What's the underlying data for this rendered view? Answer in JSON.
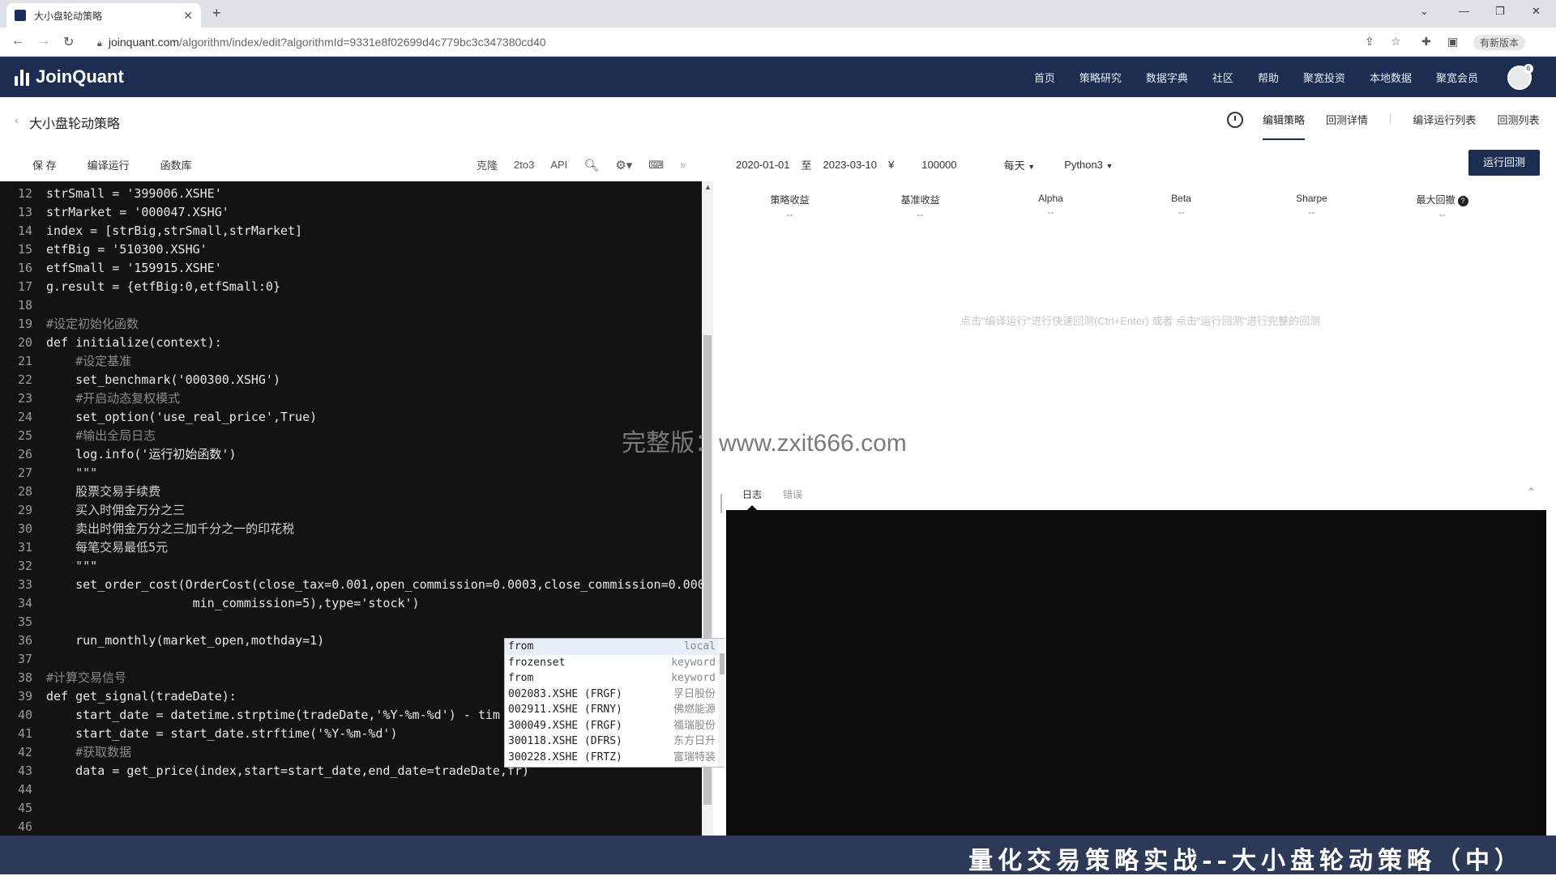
{
  "browser": {
    "tab_title": "大小盘轮动策略",
    "url_host": "joinquant.com",
    "url_path": "/algorithm/index/edit?algorithmId=9331e8f02699d4c779bc3c347380cd40",
    "profile_label": "有新版本"
  },
  "site": {
    "logo": "JoinQuant",
    "nav": [
      "首页",
      "策略研究",
      "数据字典",
      "社区",
      "帮助",
      "聚宽投资",
      "本地数据",
      "聚宽会员"
    ],
    "avatar_badge": "6"
  },
  "strategy": {
    "title": "大小盘轮动策略",
    "right_tabs": [
      "编辑策略",
      "回测详情",
      "编译运行列表",
      "回测列表"
    ]
  },
  "toolbar": {
    "save": "保 存",
    "compile_run": "编译运行",
    "function_lib": "函数库",
    "clone": "克隆",
    "to3": "2to3",
    "api": "API",
    "start_date": "2020-01-01",
    "to_label": "至",
    "end_date": "2023-03-10",
    "currency": "¥",
    "capital": "100000",
    "frequency": "每天",
    "language": "Python3",
    "run_backtest": "运行回测"
  },
  "editor": {
    "lines": [
      {
        "n": "12",
        "t": "strSmall = '399006.XSHE'",
        "k": "code"
      },
      {
        "n": "13",
        "t": "strMarket = '000047.XSHG'",
        "k": "code"
      },
      {
        "n": "14",
        "t": "index = [strBig,strSmall,strMarket]",
        "k": "code"
      },
      {
        "n": "15",
        "t": "etfBig = '510300.XSHG'",
        "k": "code"
      },
      {
        "n": "16",
        "t": "etfSmall = '159915.XSHE'",
        "k": "code"
      },
      {
        "n": "17",
        "t": "g.result = {etfBig:0,etfSmall:0}",
        "k": "code"
      },
      {
        "n": "18",
        "t": "",
        "k": "code"
      },
      {
        "n": "19",
        "t": "#设定初始化函数",
        "k": "cm"
      },
      {
        "n": "20",
        "t": "def initialize(context):",
        "k": "code"
      },
      {
        "n": "21",
        "t": "    #设定基准",
        "k": "cm"
      },
      {
        "n": "22",
        "t": "    set_benchmark('000300.XSHG')",
        "k": "code"
      },
      {
        "n": "23",
        "t": "    #开启动态复权模式",
        "k": "cm"
      },
      {
        "n": "24",
        "t": "    set_option('use_real_price',True)",
        "k": "code"
      },
      {
        "n": "25",
        "t": "    #输出全局日志",
        "k": "cm"
      },
      {
        "n": "26",
        "t": "    log.info('运行初始函数')",
        "k": "code"
      },
      {
        "n": "27",
        "t": "    \"\"\"",
        "k": "ds"
      },
      {
        "n": "28",
        "t": "    股票交易手续费",
        "k": "ds"
      },
      {
        "n": "29",
        "t": "    买入时佣金万分之三",
        "k": "ds"
      },
      {
        "n": "30",
        "t": "    卖出时佣金万分之三加千分之一的印花税",
        "k": "ds"
      },
      {
        "n": "31",
        "t": "    每笔交易最低5元",
        "k": "ds"
      },
      {
        "n": "32",
        "t": "    \"\"\"",
        "k": "ds"
      },
      {
        "n": "33",
        "t": "    set_order_cost(OrderCost(close_tax=0.001,open_commission=0.0003,close_commission=0.000",
        "k": "code"
      },
      {
        "n": "34",
        "t": "                    min_commission=5),type='stock')",
        "k": "code"
      },
      {
        "n": "35",
        "t": "",
        "k": "code"
      },
      {
        "n": "36",
        "t": "    run_monthly(market_open,mothday=1)",
        "k": "code"
      },
      {
        "n": "37",
        "t": "",
        "k": "code"
      },
      {
        "n": "38",
        "t": "#计算交易信号",
        "k": "cm"
      },
      {
        "n": "39",
        "t": "def get_signal(tradeDate):",
        "k": "code"
      },
      {
        "n": "40",
        "t": "    start_date = datetime.strptime(tradeDate,'%Y-%m-%d') - tim",
        "k": "code"
      },
      {
        "n": "41",
        "t": "    start_date = start_date.strftime('%Y-%m-%d')",
        "k": "code"
      },
      {
        "n": "42",
        "t": "    #获取数据",
        "k": "cm"
      },
      {
        "n": "43",
        "t": "    data = get_price(index,start=start_date,end_date=tradeDate,fr)",
        "k": "code"
      },
      {
        "n": "44",
        "t": "",
        "k": "code"
      },
      {
        "n": "45",
        "t": "",
        "k": "code"
      },
      {
        "n": "46",
        "t": "",
        "k": "code"
      }
    ]
  },
  "autocomplete": [
    {
      "name": "from",
      "meta": "local"
    },
    {
      "name": "frozenset",
      "meta": "keyword"
    },
    {
      "name": "from",
      "meta": "keyword"
    },
    {
      "name": "002083.XSHE (FRGF)",
      "meta": "孚日股份"
    },
    {
      "name": "002911.XSHE (FRNY)",
      "meta": "佛燃能源"
    },
    {
      "name": "300049.XSHE (FRGF)",
      "meta": "福瑞股份"
    },
    {
      "name": "300118.XSHE (DFRS)",
      "meta": "东方日升"
    },
    {
      "name": "300228.XSHE (FRTZ)",
      "meta": "富瑞特装"
    }
  ],
  "results": {
    "metrics": [
      {
        "label": "策略收益",
        "value": "--"
      },
      {
        "label": "基准收益",
        "value": "--"
      },
      {
        "label": "Alpha",
        "value": "--"
      },
      {
        "label": "Beta",
        "value": "--"
      },
      {
        "label": "Sharpe",
        "value": "--"
      },
      {
        "label": "最大回撤",
        "value": "--"
      }
    ],
    "hint": "点击\"编译运行\"进行快速回测(Ctrl+Enter) 或者 点击\"运行回测\"进行完整的回测",
    "log_tabs": [
      "日志",
      "错误"
    ]
  },
  "watermark": "完整版：www.zxit666.com",
  "caption": "量化交易策略实战--大小盘轮动策略（中）"
}
